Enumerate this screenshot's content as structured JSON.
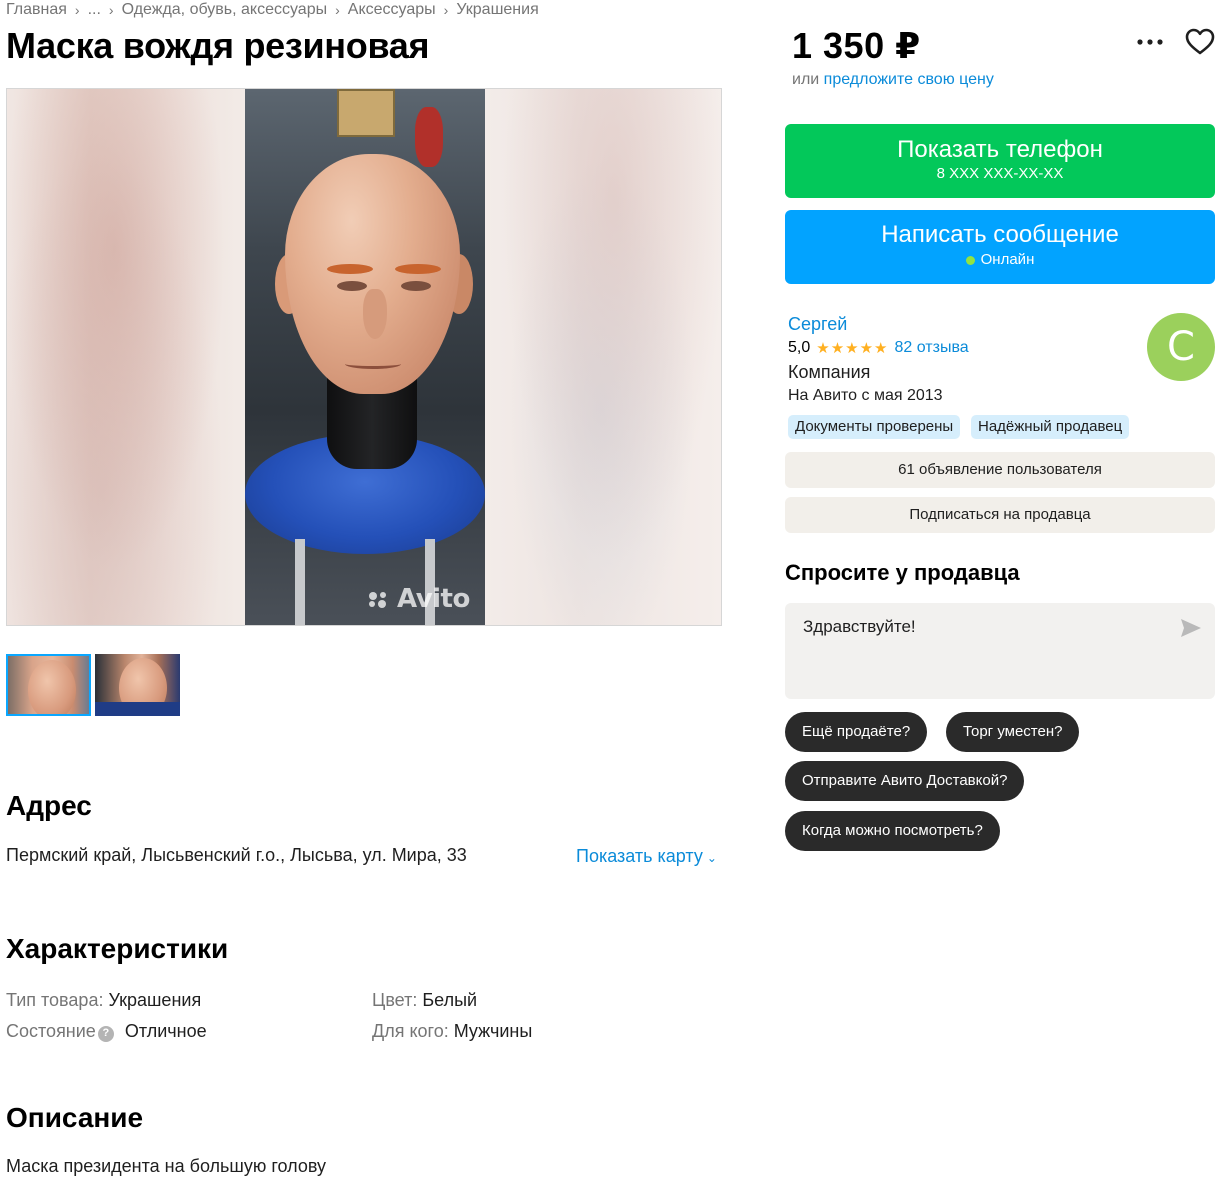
{
  "breadcrumb": [
    "Главная",
    "...",
    "Одежда, обувь, аксессуары",
    "Аксессуары",
    "Украшения"
  ],
  "title": "Маска вождя резиновая",
  "price": "1 350 ₽",
  "offer": {
    "prefix": "или",
    "link": "предложите свою цену"
  },
  "gallery": {
    "watermark": "Avito",
    "thumbnails": 2,
    "active_thumbnail": 1
  },
  "buttons": {
    "phone_label": "Показать телефон",
    "phone_number": "8 XXX XXX-XX-XX",
    "message_label": "Написать сообщение",
    "message_status": "Онлайн"
  },
  "seller": {
    "name": "Сергей",
    "rating": "5,0",
    "stars": "★★★★★",
    "reviews": "82 отзыва",
    "type": "Компания",
    "since": "На Авито с мая 2013",
    "badges": [
      "Документы проверены",
      "Надёжный продавец"
    ],
    "avatar_letter": "С",
    "avatar_color": "#9bd05c"
  },
  "seller_actions": {
    "listings": "61 объявление пользователя",
    "subscribe": "Подписаться на продавца"
  },
  "ask": {
    "title": "Спросите у продавца",
    "message": "Здравствуйте!",
    "chips": [
      "Ещё продаёте?",
      "Торг уместен?",
      "Отправите Авито Доставкой?",
      "Когда можно посмотреть?"
    ]
  },
  "address": {
    "heading": "Адрес",
    "text": "Пермский край, Лысьвенский г.о., Лысьва, ул. Мира, 33",
    "map_link": "Показать карту"
  },
  "characteristics": {
    "heading": "Характеристики",
    "items": [
      {
        "key": "Тип товара:",
        "value": "Украшения"
      },
      {
        "key": "Состояние",
        "value": "Отличное"
      },
      {
        "key": "Цвет:",
        "value": "Белый"
      },
      {
        "key": "Для кого:",
        "value": "Мужчины"
      }
    ]
  },
  "description": {
    "heading": "Описание",
    "text": "Маска президента на большую голову"
  },
  "colors": {
    "phone_button": "#03c85a",
    "message_button": "#02a3ff",
    "link": "#0b8bd9",
    "star": "#ffb021"
  },
  "icons": [
    "more-icon",
    "heart-icon",
    "chevron-down-icon",
    "question-icon",
    "send-icon",
    "online-dot-icon",
    "chevron-right-icon"
  ]
}
